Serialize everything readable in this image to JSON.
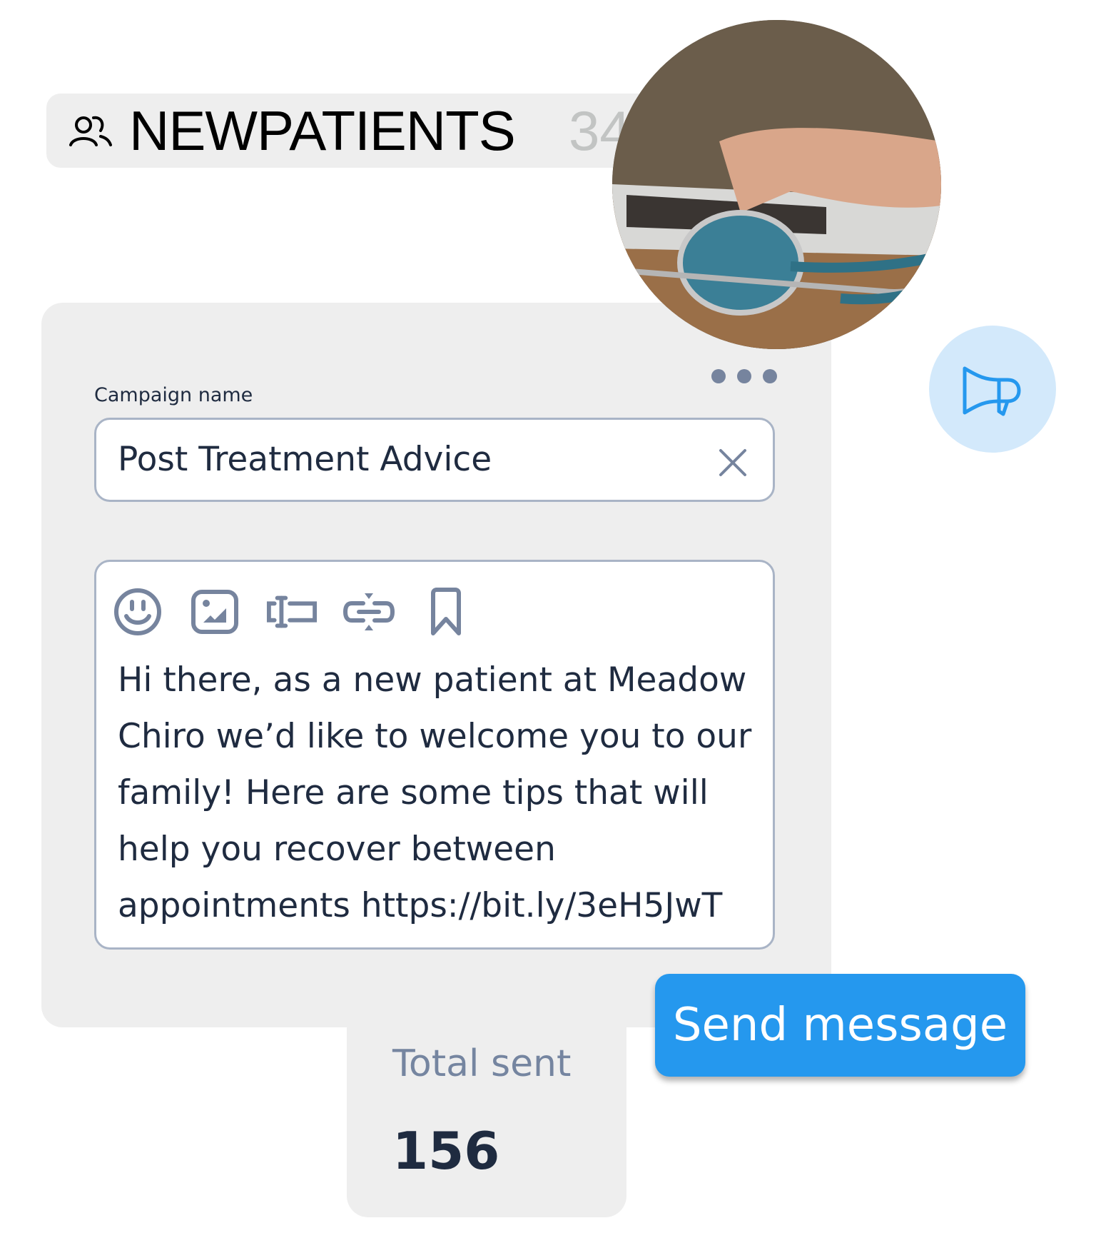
{
  "group_tag": {
    "icon": "people-icon",
    "name": "NEWPATIENTS",
    "count": "34"
  },
  "photo": {
    "alt": "Hands typing on laptop with stethoscope"
  },
  "megaphone_badge": {
    "icon": "megaphone-icon",
    "color": "#2598ee",
    "background": "#d3e9fb"
  },
  "campaign": {
    "more_icon": "more-dots-icon",
    "name_label": "Campaign name",
    "name_value": "Post Treatment Advice",
    "clear_icon": "close-icon"
  },
  "editor": {
    "toolbar": [
      {
        "icon": "emoji-icon"
      },
      {
        "icon": "image-icon"
      },
      {
        "icon": "text-field-icon"
      },
      {
        "icon": "link-shorten-icon"
      },
      {
        "icon": "bookmark-icon"
      }
    ],
    "message": "Hi there, as a new patient at Meadow Chiro we’d like to welcome you to our family! Here are some tips that will help you recover between appointments https://bit.ly/3eH5JwT"
  },
  "stats": {
    "total_sent_label": "Total sent",
    "total_sent_value": "156"
  },
  "actions": {
    "send_label": "Send message",
    "send_color": "#2598ee"
  }
}
